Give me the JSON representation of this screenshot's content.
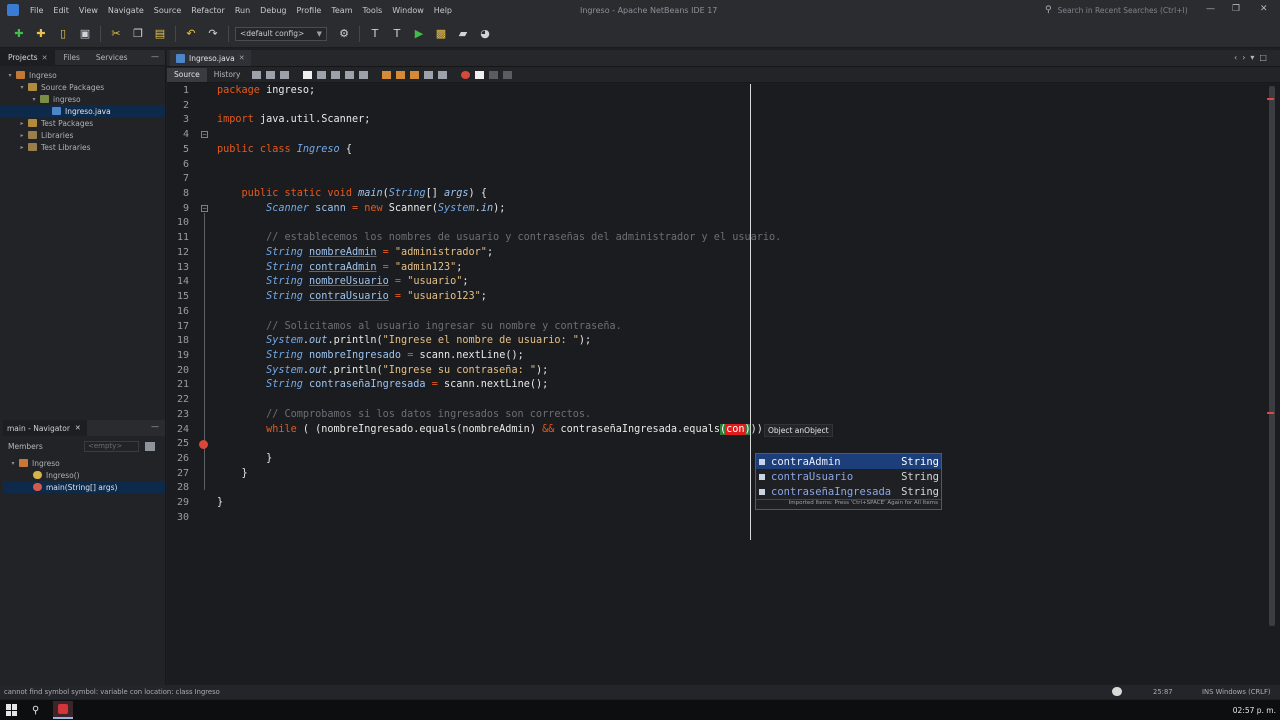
{
  "window": {
    "title": "Ingreso - Apache NetBeans IDE 17",
    "menu": [
      "File",
      "Edit",
      "View",
      "Navigate",
      "Source",
      "Refactor",
      "Run",
      "Debug",
      "Profile",
      "Team",
      "Tools",
      "Window",
      "Help"
    ],
    "search_placeholder": "Search in Recent Searches (Ctrl+I)",
    "controls": [
      "—",
      "❐",
      "✕"
    ]
  },
  "toolbar": {
    "config": "<default config>"
  },
  "projects_panel": {
    "tabs": [
      "Projects",
      "Files",
      "Services"
    ],
    "tree": [
      {
        "label": "Ingreso",
        "depth": 0,
        "icon": "project-icon"
      },
      {
        "label": "Source Packages",
        "depth": 1,
        "icon": "folder-icon"
      },
      {
        "label": "ingreso",
        "depth": 2,
        "icon": "package-icon"
      },
      {
        "label": "Ingreso.java",
        "depth": 3,
        "icon": "java-file-icon",
        "selected": true
      },
      {
        "label": "Test Packages",
        "depth": 1,
        "icon": "folder-icon"
      },
      {
        "label": "Libraries",
        "depth": 1,
        "icon": "library-icon"
      },
      {
        "label": "Test Libraries",
        "depth": 1,
        "icon": "library-icon"
      }
    ]
  },
  "navigator": {
    "title": "main - Navigator",
    "filter_label": "Members",
    "filter_value": "<empty>",
    "tree": [
      {
        "label": "Ingreso",
        "depth": 0
      },
      {
        "label": "Ingreso()",
        "depth": 1
      },
      {
        "label": "main(String[] args)",
        "depth": 1,
        "selected": true
      }
    ]
  },
  "editor": {
    "tab": "Ingreso.java",
    "modes": [
      "Source",
      "History"
    ],
    "lines": [
      [
        [
          "pk",
          "package"
        ],
        [
          "cls",
          " ingreso;"
        ]
      ],
      [],
      [
        [
          "kw",
          "import"
        ],
        [
          "cls",
          " java.util.Scanner;"
        ]
      ],
      [],
      [
        [
          "kw",
          "public class"
        ],
        [
          "cls",
          " "
        ],
        [
          "ty",
          "Ingreso"
        ],
        [
          "cls",
          " {"
        ]
      ],
      [],
      [],
      [
        [
          "cls",
          "    "
        ],
        [
          "kw",
          "public static void"
        ],
        [
          "cls",
          " "
        ],
        [
          "it",
          "main"
        ],
        [
          "cls",
          "("
        ],
        [
          "ty",
          "String"
        ],
        [
          "cls",
          "[] "
        ],
        [
          "it",
          "args"
        ],
        [
          "cls",
          ") {"
        ]
      ],
      [
        [
          "cls",
          "        "
        ],
        [
          "ty",
          "Scanner"
        ],
        [
          "cls",
          " "
        ],
        [
          "id",
          "scann"
        ],
        [
          "cls",
          " "
        ],
        [
          "op",
          "="
        ],
        [
          "cls",
          " "
        ],
        [
          "kw",
          "new"
        ],
        [
          "cls",
          " Scanner("
        ],
        [
          "ty",
          "System"
        ],
        [
          "cls",
          "."
        ],
        [
          "it",
          "in"
        ],
        [
          "cls",
          ");"
        ]
      ],
      [],
      [
        [
          "com",
          "        // establecemos los nombres de usuario y contraseñas del administrador y el usuario."
        ]
      ],
      [
        [
          "cls",
          "        "
        ],
        [
          "ty",
          "String"
        ],
        [
          "cls",
          " "
        ],
        [
          "idu",
          "nombreAdmin"
        ],
        [
          "cls",
          " "
        ],
        [
          "op",
          "="
        ],
        [
          "cls",
          " "
        ],
        [
          "str",
          "\"administrador\""
        ],
        [
          "cls",
          ";"
        ]
      ],
      [
        [
          "cls",
          "        "
        ],
        [
          "ty",
          "String"
        ],
        [
          "cls",
          " "
        ],
        [
          "idu",
          "contraAdmin"
        ],
        [
          "cls",
          " "
        ],
        [
          "op",
          "="
        ],
        [
          "cls",
          " "
        ],
        [
          "str",
          "\"admin123\""
        ],
        [
          "cls",
          ";"
        ]
      ],
      [
        [
          "cls",
          "        "
        ],
        [
          "ty",
          "String"
        ],
        [
          "cls",
          " "
        ],
        [
          "idu",
          "nombreUsuario"
        ],
        [
          "cls",
          " "
        ],
        [
          "op",
          "="
        ],
        [
          "cls",
          " "
        ],
        [
          "str",
          "\"usuario\""
        ],
        [
          "cls",
          ";"
        ]
      ],
      [
        [
          "cls",
          "        "
        ],
        [
          "ty",
          "String"
        ],
        [
          "cls",
          " "
        ],
        [
          "idu",
          "contraUsuario"
        ],
        [
          "cls",
          " "
        ],
        [
          "op",
          "="
        ],
        [
          "cls",
          " "
        ],
        [
          "str",
          "\"usuario123\""
        ],
        [
          "cls",
          ";"
        ]
      ],
      [],
      [
        [
          "com",
          "        // Solicitamos al usuario ingresar su nombre y contraseña."
        ]
      ],
      [
        [
          "cls",
          "        "
        ],
        [
          "ty",
          "System"
        ],
        [
          "cls",
          "."
        ],
        [
          "it",
          "out"
        ],
        [
          "cls",
          ".println("
        ],
        [
          "str",
          "\"Ingrese el nombre de usuario: \""
        ],
        [
          "cls",
          ");"
        ]
      ],
      [
        [
          "cls",
          "        "
        ],
        [
          "ty",
          "String"
        ],
        [
          "cls",
          " "
        ],
        [
          "id",
          "nombreIngresado"
        ],
        [
          "cls",
          " "
        ],
        [
          "op",
          "="
        ],
        [
          "cls",
          " scann.nextLine();"
        ]
      ],
      [
        [
          "cls",
          "        "
        ],
        [
          "ty",
          "System"
        ],
        [
          "cls",
          "."
        ],
        [
          "it",
          "out"
        ],
        [
          "cls",
          ".println("
        ],
        [
          "str",
          "\"Ingrese su contraseña: \""
        ],
        [
          "cls",
          ");"
        ]
      ],
      [
        [
          "cls",
          "        "
        ],
        [
          "ty",
          "String"
        ],
        [
          "cls",
          " "
        ],
        [
          "id",
          "contraseñaIngresada"
        ],
        [
          "cls",
          " "
        ],
        [
          "op",
          "="
        ],
        [
          "cls",
          " scann.nextLine();"
        ]
      ],
      [],
      [
        [
          "com",
          "        // Comprobamos si los datos ingresados son correctos."
        ]
      ],
      [
        [
          "cls",
          "        "
        ],
        [
          "kw",
          "while"
        ],
        [
          "cls",
          " ( (nombreIngresado.equals(nombreAdmin) "
        ],
        [
          "op",
          "&&"
        ],
        [
          "cls",
          " contraseñaIngresada.equals"
        ],
        [
          "brk",
          "("
        ],
        [
          "hl",
          "con"
        ],
        [
          "brk",
          ")"
        ],
        [
          "cls",
          ")) {"
        ]
      ],
      [],
      [
        [
          "cls",
          "        }"
        ]
      ],
      [
        [
          "cls",
          "    }"
        ]
      ],
      [],
      [
        [
          "cls",
          "}"
        ]
      ],
      []
    ],
    "tooltip": "Object anObject",
    "completion": [
      {
        "name": "contraAdmin",
        "type": "String",
        "selected": true
      },
      {
        "name": "contraUsuario",
        "type": "String"
      },
      {
        "name": "contraseñaIngresada",
        "type": "String"
      }
    ],
    "completion_hint": "Imported Items: Press 'Ctrl+SPACE' Again for All Items"
  },
  "status": {
    "message": "cannot find symbol   symbol:   variable con   location: class Ingreso",
    "position": "25:87",
    "mode": "INS  Windows (CRLF)"
  },
  "taskbar": {
    "clock": "02:57 p. m."
  },
  "colors": {
    "keyword": "#e6591d",
    "type": "#73a9e8",
    "string": "#e5bf85",
    "comment": "#6b6e75",
    "selection": "#1c3f7c",
    "error": "#e01b1b"
  }
}
